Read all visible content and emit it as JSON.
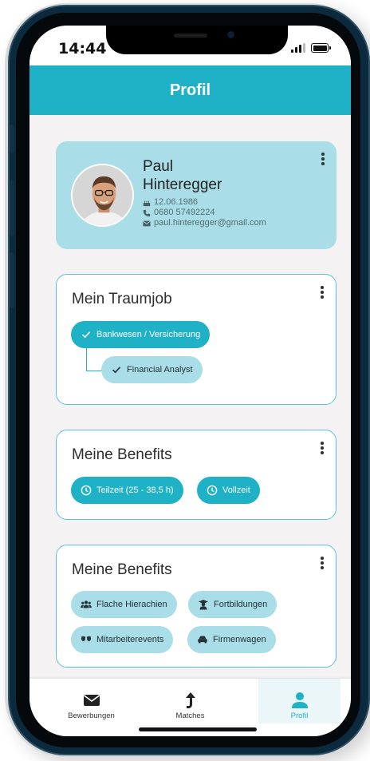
{
  "status_bar": {
    "time": "14:44"
  },
  "header": {
    "title": "Profil"
  },
  "profile": {
    "name_first": "Paul",
    "name_last": "Hinteregger",
    "birthdate": "12.06.1986",
    "phone": "0680 57492224",
    "email": "paul.hinteregger@gmail.com"
  },
  "traumjob": {
    "title": "Mein Traumjob",
    "parent": "Bankwesen / Versicherung",
    "child": "Financial Analyst"
  },
  "benefits": {
    "title": "Meine Benefits",
    "items": [
      "Teilzeit (25 - 38,5 h)",
      "Vollzeit"
    ]
  },
  "benefits2": {
    "title": "Meine Benefits",
    "items": [
      "Flache Hierachien",
      "Fortbildungen",
      "Mitarbeiterevents",
      "Firmenwagen"
    ]
  },
  "nav": {
    "items": [
      {
        "label": "Bewerbungen",
        "icon": "mail-icon"
      },
      {
        "label": "Matches",
        "icon": "arrow-up-icon"
      },
      {
        "label": "Profil",
        "icon": "user-icon"
      }
    ],
    "active": "Profil"
  },
  "colors": {
    "accent": "#1fb1c6",
    "accent_light": "#a9dde7",
    "background": "#f4f2f3"
  }
}
